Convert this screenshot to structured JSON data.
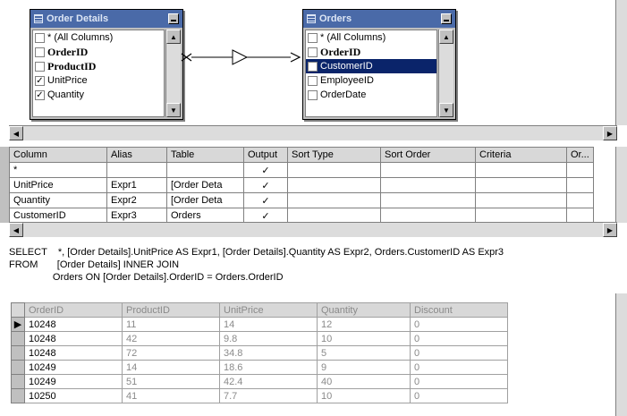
{
  "diagram": {
    "tables": [
      {
        "title": "Order Details",
        "rows": [
          {
            "label": "* (All Columns)",
            "checked": false,
            "bold": false,
            "selected": false
          },
          {
            "label": "OrderID",
            "checked": false,
            "bold": true,
            "selected": false
          },
          {
            "label": "ProductID",
            "checked": false,
            "bold": true,
            "selected": false
          },
          {
            "label": "UnitPrice",
            "checked": true,
            "bold": false,
            "selected": false
          },
          {
            "label": "Quantity",
            "checked": true,
            "bold": false,
            "selected": false
          }
        ]
      },
      {
        "title": "Orders",
        "rows": [
          {
            "label": "* (All Columns)",
            "checked": false,
            "bold": false,
            "selected": false
          },
          {
            "label": "OrderID",
            "checked": false,
            "bold": true,
            "selected": false
          },
          {
            "label": "CustomerID",
            "checked": true,
            "bold": false,
            "selected": true
          },
          {
            "label": "EmployeeID",
            "checked": false,
            "bold": false,
            "selected": false
          },
          {
            "label": "OrderDate",
            "checked": false,
            "bold": false,
            "selected": false
          }
        ]
      }
    ]
  },
  "grid": {
    "headers": [
      "Column",
      "Alias",
      "Table",
      "Output",
      "Sort Type",
      "Sort Order",
      "Criteria",
      "Or..."
    ],
    "rows": [
      [
        "*",
        "",
        "",
        "✓",
        "",
        "",
        "",
        ""
      ],
      [
        "UnitPrice",
        "Expr1",
        "[Order Deta",
        "✓",
        "",
        "",
        "",
        ""
      ],
      [
        "Quantity",
        "Expr2",
        "[Order Deta",
        "✓",
        "",
        "",
        "",
        ""
      ],
      [
        "CustomerID",
        "Expr3",
        "Orders",
        "✓",
        "",
        "",
        "",
        ""
      ]
    ]
  },
  "sql": {
    "line1": "SELECT    *, [Order Details].UnitPrice AS Expr1, [Order Details].Quantity AS Expr2, Orders.CustomerID AS Expr3",
    "line2": "FROM       [Order Details] INNER JOIN",
    "line3": "                Orders ON [Order Details].OrderID = Orders.OrderID"
  },
  "results": {
    "headers": [
      "OrderID",
      "ProductID",
      "UnitPrice",
      "Quantity",
      "Discount"
    ],
    "rows": [
      [
        "10248",
        "11",
        "14",
        "12",
        "0"
      ],
      [
        "10248",
        "42",
        "9.8",
        "10",
        "0"
      ],
      [
        "10248",
        "72",
        "34.8",
        "5",
        "0"
      ],
      [
        "10249",
        "14",
        "18.6",
        "9",
        "0"
      ],
      [
        "10249",
        "51",
        "42.4",
        "40",
        "0"
      ],
      [
        "10250",
        "41",
        "7.7",
        "10",
        "0"
      ]
    ],
    "current_row_marker": "▶"
  },
  "icons": {
    "check": "✓",
    "scroll_up": "▲",
    "scroll_down": "▼",
    "scroll_left": "◀",
    "scroll_right": "▶"
  }
}
